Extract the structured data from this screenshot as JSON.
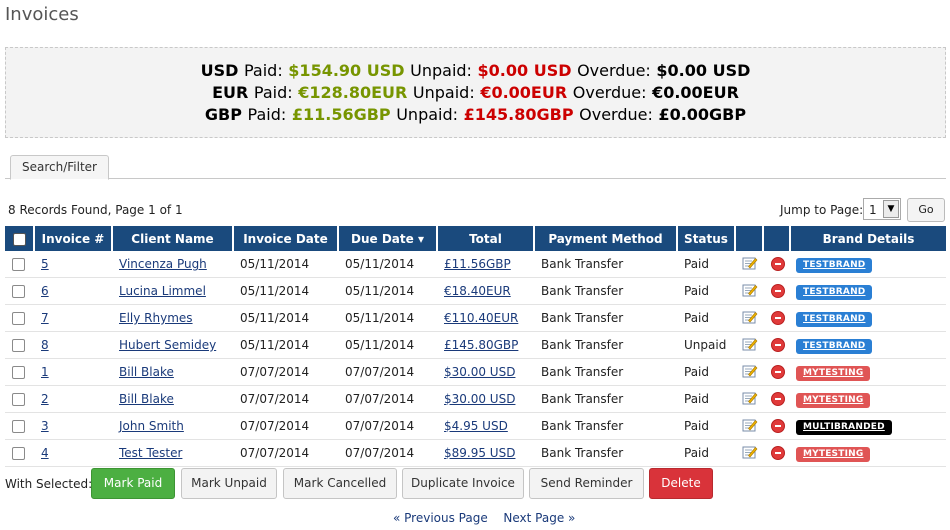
{
  "page_title": "Invoices",
  "summary": [
    {
      "currency": "USD",
      "paid_label": "Paid:",
      "paid": "$154.90 USD",
      "unpaid_label": "Unpaid:",
      "unpaid": "$0.00 USD",
      "overdue_label": "Overdue:",
      "overdue": "$0.00 USD"
    },
    {
      "currency": "EUR",
      "paid_label": "Paid:",
      "paid": "€128.80EUR",
      "unpaid_label": "Unpaid:",
      "unpaid": "€0.00EUR",
      "overdue_label": "Overdue:",
      "overdue": "€0.00EUR"
    },
    {
      "currency": "GBP",
      "paid_label": "Paid:",
      "paid": "£11.56GBP",
      "unpaid_label": "Unpaid:",
      "unpaid": "£145.80GBP",
      "overdue_label": "Overdue:",
      "overdue": "£0.00GBP"
    }
  ],
  "tabs": {
    "search_filter": "Search/Filter"
  },
  "records_text": "8 Records Found, Page 1 of 1",
  "jump": {
    "label": "Jump to Page:",
    "selected": "1",
    "go_label": "Go"
  },
  "table": {
    "headers": [
      "Invoice #",
      "Client Name",
      "Invoice Date",
      "Due Date ▾",
      "Total",
      "Payment Method",
      "Status",
      "",
      "",
      "Brand Details"
    ],
    "rows": [
      {
        "invoice": "5",
        "client": "Vincenza Pugh",
        "invoice_date": "05/11/2014",
        "due_date": "05/11/2014",
        "total": "£11.56GBP",
        "method": "Bank Transfer",
        "status": "Paid",
        "brand": "TESTBRAND",
        "brand_color": "#2a7fd4"
      },
      {
        "invoice": "6",
        "client": "Lucina Limmel",
        "invoice_date": "05/11/2014",
        "due_date": "05/11/2014",
        "total": "€18.40EUR",
        "method": "Bank Transfer",
        "status": "Paid",
        "brand": "TESTBRAND",
        "brand_color": "#2a7fd4"
      },
      {
        "invoice": "7",
        "client": "Elly Rhymes",
        "invoice_date": "05/11/2014",
        "due_date": "05/11/2014",
        "total": "€110.40EUR",
        "method": "Bank Transfer",
        "status": "Paid",
        "brand": "TESTBRAND",
        "brand_color": "#2a7fd4"
      },
      {
        "invoice": "8",
        "client": "Hubert Semidey",
        "invoice_date": "05/11/2014",
        "due_date": "05/11/2014",
        "total": "£145.80GBP",
        "method": "Bank Transfer",
        "status": "Unpaid",
        "brand": "TESTBRAND",
        "brand_color": "#2a7fd4"
      },
      {
        "invoice": "1",
        "client": "Bill Blake",
        "invoice_date": "07/07/2014",
        "due_date": "07/07/2014",
        "total": "$30.00 USD",
        "method": "Bank Transfer",
        "status": "Paid",
        "brand": "MYTESTING",
        "brand_color": "#e05555"
      },
      {
        "invoice": "2",
        "client": "Bill Blake",
        "invoice_date": "07/07/2014",
        "due_date": "07/07/2014",
        "total": "$30.00 USD",
        "method": "Bank Transfer",
        "status": "Paid",
        "brand": "MYTESTING",
        "brand_color": "#e05555"
      },
      {
        "invoice": "3",
        "client": "John Smith",
        "invoice_date": "07/07/2014",
        "due_date": "07/07/2014",
        "total": "$4.95 USD",
        "method": "Bank Transfer",
        "status": "Paid",
        "brand": "MULTIBRANDED",
        "brand_color": "#000000"
      },
      {
        "invoice": "4",
        "client": "Test Tester",
        "invoice_date": "07/07/2014",
        "due_date": "07/07/2014",
        "total": "$89.95 USD",
        "method": "Bank Transfer",
        "status": "Paid",
        "brand": "MYTESTING",
        "brand_color": "#e05555"
      }
    ]
  },
  "actions": {
    "label": "With Selected:",
    "mark_paid": "Mark Paid",
    "mark_unpaid": "Mark Unpaid",
    "mark_cancelled": "Mark Cancelled",
    "duplicate": "Duplicate Invoice",
    "send_reminder": "Send Reminder",
    "delete": "Delete"
  },
  "pager": {
    "prev": "« Previous Page",
    "next": "Next Page »"
  },
  "colors": {
    "header_bg": "#1a4a7d",
    "paid": "#779500",
    "unpaid": "#cc0000"
  },
  "icons": {
    "edit": "edit-invoice-icon",
    "delete": "delete-icon"
  }
}
